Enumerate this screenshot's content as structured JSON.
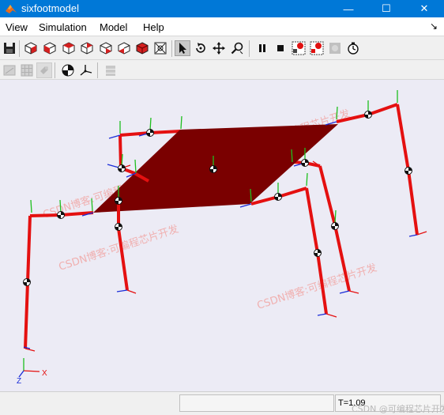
{
  "window": {
    "title": "sixfootmodel",
    "minimize_label": "—",
    "maximize_label": "☐",
    "close_label": "✕"
  },
  "menubar": {
    "items": [
      "View",
      "Simulation",
      "Model",
      "Help"
    ],
    "overflow_arrow": "↘"
  },
  "toolbar_row1": {
    "icons": [
      "save-icon",
      "view-iso-cube-icon",
      "view-front-cube-icon",
      "view-side-cube-icon",
      "view-top-cube-icon",
      "view-right-cube-icon",
      "view-back-cube-icon",
      "view-bottom-cube-icon",
      "fit-to-view-icon",
      "select-pointer-icon",
      "rotate-icon",
      "pan-icon",
      "zoom-icon",
      "pause-icon",
      "stop-icon",
      "record-icon",
      "record-settings-icon",
      "record-disabled-icon",
      "timer-icon"
    ]
  },
  "toolbar_row2": {
    "icons": [
      "display-option-icon",
      "grid-toggle-icon",
      "show-frames-icon",
      "center-of-mass-icon",
      "frame-axes-icon",
      "layers-icon"
    ]
  },
  "canvas": {
    "background": "#ecebf5",
    "platform_color": "#7a0000",
    "leg_color": "#e41010",
    "watermarks": [
      "CSDN博客:可编程芯片开发",
      "CSDN博客:可编程芯片开发",
      "CSDN博客:可编程芯片开发",
      "CSDN博客:可编程芯片开发",
      "CSDN博客:可编程芯片开发"
    ],
    "axis_labels": {
      "x": "X",
      "z": "Z"
    }
  },
  "statusbar": {
    "time": "T=1.09",
    "corner_watermark": "CSDN @可编程芯片开发"
  }
}
